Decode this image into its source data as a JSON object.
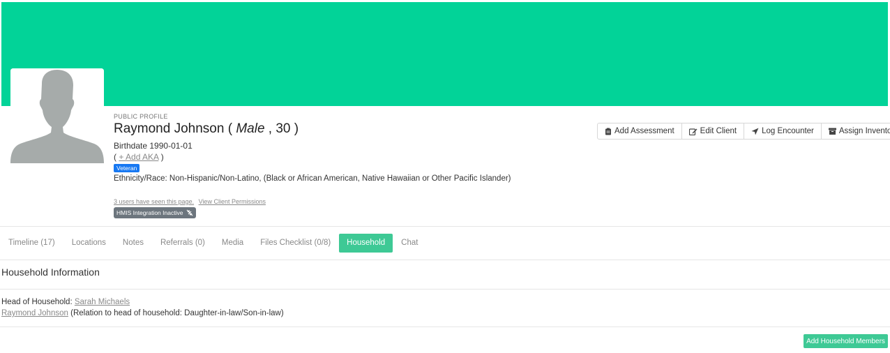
{
  "colors": {
    "banner": "#02d398",
    "accent": "#3ec995",
    "veteran_badge": "#1778f2",
    "hmis_badge": "#6c757d"
  },
  "profile": {
    "label": "PUBLIC PROFILE",
    "name": "Raymond Johnson",
    "gender": "Male",
    "age": "30",
    "birthdate_label": "Birthdate",
    "birthdate": "1990-01-01",
    "add_aka": "+ Add AKA",
    "veteran_badge": "Veteran",
    "ethnicity_label": "Ethnicity/Race:",
    "ethnicity_value": "Non-Hispanic/Non-Latino, (Black or African American, Native Hawaiian or Other Pacific Islander)",
    "seen_text": "3 users have seen this page.",
    "permissions_link": "View Client Permissions",
    "hmis_badge": "HMIS Integration Inactive"
  },
  "actions": [
    {
      "label": "Add Assessment",
      "icon": "clipboard-icon"
    },
    {
      "label": "Edit Client",
      "icon": "edit-icon"
    },
    {
      "label": "Log Encounter",
      "icon": "location-arrow-icon"
    },
    {
      "label": "Assign Inventory",
      "icon": "archive-icon"
    }
  ],
  "tabs": [
    {
      "label": "Timeline (17)",
      "active": false
    },
    {
      "label": "Locations",
      "active": false
    },
    {
      "label": "Notes",
      "active": false
    },
    {
      "label": "Referrals (0)",
      "active": false
    },
    {
      "label": "Media",
      "active": false
    },
    {
      "label": "Files Checklist (0/8)",
      "active": false
    },
    {
      "label": "Household",
      "active": true
    },
    {
      "label": "Chat",
      "active": false
    }
  ],
  "household": {
    "title": "Household Information",
    "head_label": "Head of Household:",
    "head_name": "Sarah Michaels",
    "member_name": "Raymond Johnson",
    "member_relation": "(Relation to head of household: Daughter-in-law/Son-in-law)",
    "add_button": "Add Household Members"
  }
}
